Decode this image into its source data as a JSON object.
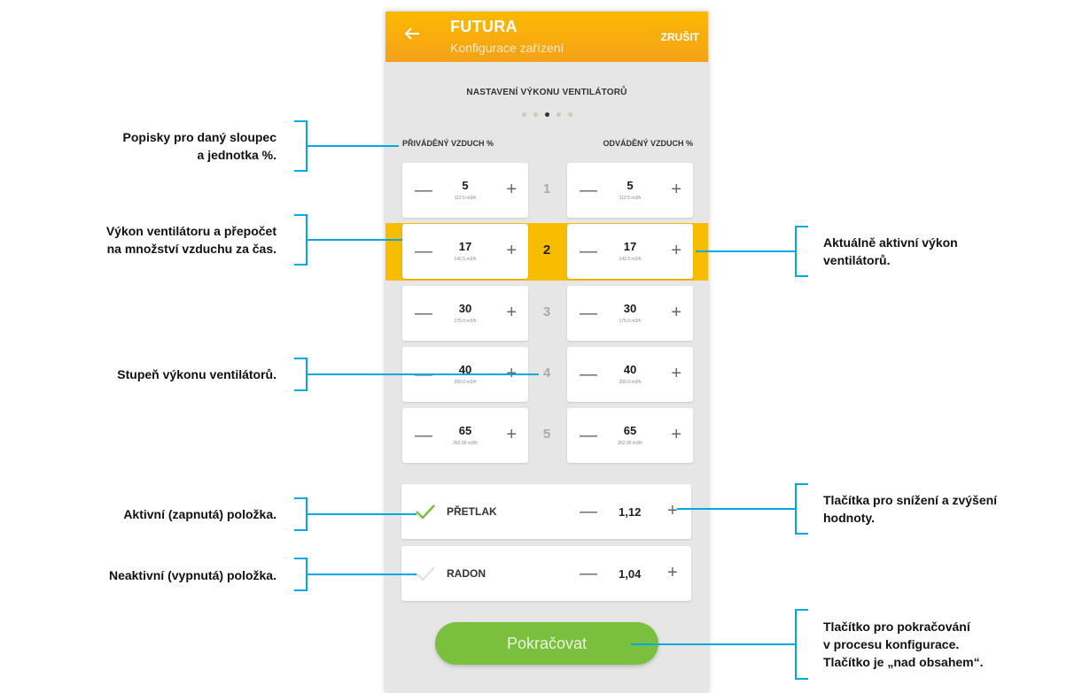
{
  "appbar": {
    "title": "FUTURA",
    "subtitle": "Konfigurace zařízení",
    "cancel_label": "ZRUŠIT",
    "color": "#f9b200"
  },
  "section": {
    "title": "NASTAVENÍ VÝKONU VENTILÁTORŮ",
    "pager_total": 5,
    "pager_active": 3
  },
  "columns": {
    "supply_label": "PŘIVÁDĚNÝ VZDUCH %",
    "exhaust_label": "ODVÁDĚNÝ VZDUCH %"
  },
  "levels": [
    {
      "level": "1",
      "supply": "5",
      "supply_flow": "112.5 m3/h",
      "exhaust": "5",
      "exhaust_flow": "112.5 m3/h"
    },
    {
      "level": "2",
      "supply": "17",
      "supply_flow": "142.5 m3/h",
      "exhaust": "17",
      "exhaust_flow": "142.5 m3/h"
    },
    {
      "level": "3",
      "supply": "30",
      "supply_flow": "175.0 m3/h",
      "exhaust": "30",
      "exhaust_flow": "175.0 m3/h"
    },
    {
      "level": "4",
      "supply": "40",
      "supply_flow": "200.0 m3/h",
      "exhaust": "40",
      "exhaust_flow": "200.0 m3/h"
    },
    {
      "level": "5",
      "supply": "65",
      "supply_flow": "262.00 m3/h",
      "exhaust": "65",
      "exhaust_flow": "262.00 m3/h"
    }
  ],
  "active_level": "2",
  "toggles": [
    {
      "label": "PŘETLAK",
      "value": "1,12",
      "active": true
    },
    {
      "label": "RADON",
      "value": "1,04",
      "active": false
    }
  ],
  "continue_label": "Pokračovat",
  "accent_green": "#7bbf3e",
  "annotation_color": "#00a9e0",
  "annotations": {
    "col_labels_1": "Popisky pro daný sloupec",
    "col_labels_2": "a jednotka %.",
    "fan_power_1": "Výkon ventilátoru a přepočet",
    "fan_power_2": "na množství vzduchu za čas.",
    "level": "Stupeň výkonu ventilátorů.",
    "active_on": "Aktivní (zapnutá) položka.",
    "inactive_off": "Neaktivní (vypnutá) položka.",
    "active_power_1": "Aktuálně aktivní výkon",
    "active_power_2": "ventilátorů.",
    "buttons_1": "Tlačítka pro snížení a zvýšení",
    "buttons_2": "hodnoty.",
    "continue_1": "Tlačítko pro pokračování",
    "continue_2": "v procesu konfigurace.",
    "continue_3": "Tlačítko je „nad obsahem“."
  }
}
